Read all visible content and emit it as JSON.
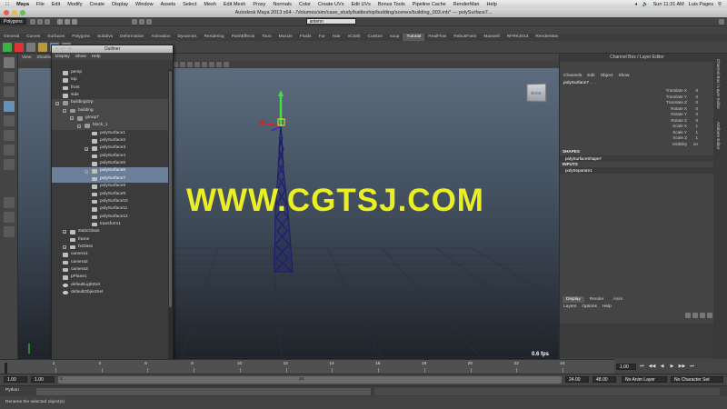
{
  "mac_menubar": {
    "apple": "",
    "app": "Maya",
    "items": [
      "File",
      "Edit",
      "Modify",
      "Create",
      "Display",
      "Window",
      "Assets",
      "Select",
      "Mesh",
      "Edit Mesh",
      "Proxy",
      "Normals",
      "Color",
      "Create UVs",
      "Edit UVs",
      "Bonus Tools",
      "Pipeline Cache",
      "RenderMan",
      "Help"
    ],
    "clock": "Sun 11:31 AM",
    "user": "Luis Pages"
  },
  "window_title": "Autodesk Maya 2013 x64 - /Volumes/sim/case_study/battleship/building/scenes/building_003.mb* --- polySurface7...",
  "status_line": {
    "menu_set": "Polygons",
    "search_value": "antenn"
  },
  "shelf": {
    "tabs": [
      "General",
      "Curves",
      "Surfaces",
      "Polygons",
      "Subdivs",
      "Deformation",
      "Animation",
      "Dynamics",
      "Rendering",
      "PaintEffects",
      "Toon",
      "Muscle",
      "Fluids",
      "Fur",
      "Hair",
      "nCloth",
      "Custom",
      "soup",
      "Tutorial",
      "RealFlow",
      "RebusFarm",
      "Maxwell",
      "RFRK2013",
      "RenderMan"
    ],
    "active_tab": "Tutorial"
  },
  "outliner": {
    "title": "Outliner",
    "menu": [
      "Display",
      "Show",
      "Help"
    ],
    "items": [
      {
        "label": "persp",
        "indent": 0
      },
      {
        "label": "top",
        "indent": 0
      },
      {
        "label": "front",
        "indent": 0
      },
      {
        "label": "side",
        "indent": 0
      },
      {
        "label": "buildingGrp",
        "indent": 0,
        "expand": "−",
        "group": true
      },
      {
        "label": "building",
        "indent": 1,
        "expand": "−",
        "group": true
      },
      {
        "label": "group7",
        "indent": 2,
        "expand": "−",
        "group": true
      },
      {
        "label": "block_1",
        "indent": 3,
        "expand": "−",
        "group": true
      },
      {
        "label": "polySurface1",
        "indent": 4
      },
      {
        "label": "polySurface2",
        "indent": 4
      },
      {
        "label": "polySurface3",
        "indent": 4,
        "expand": "+"
      },
      {
        "label": "polySurface4",
        "indent": 4
      },
      {
        "label": "polySurface5",
        "indent": 4
      },
      {
        "label": "polySurface6",
        "indent": 4,
        "selected": true,
        "expand": "+"
      },
      {
        "label": "polySurface7",
        "indent": 4,
        "selected": true
      },
      {
        "label": "polySurface8",
        "indent": 4
      },
      {
        "label": "polySurface9",
        "indent": 4
      },
      {
        "label": "polySurface10",
        "indent": 4
      },
      {
        "label": "polySurface11",
        "indent": 4
      },
      {
        "label": "polySurface12",
        "indent": 4
      },
      {
        "label": "transform1",
        "indent": 4
      },
      {
        "label": "staticGlass",
        "indent": 1,
        "expand": "+"
      },
      {
        "label": "frame",
        "indent": 1
      },
      {
        "label": "fxGlass",
        "indent": 1,
        "expand": "+"
      },
      {
        "label": "camera1",
        "indent": 0
      },
      {
        "label": "camera2",
        "indent": 0
      },
      {
        "label": "camera3",
        "indent": 0
      },
      {
        "label": "pPlane1",
        "indent": 0
      },
      {
        "label": "defaultLightSet",
        "indent": 0,
        "set": true
      },
      {
        "label": "defaultObjectSet",
        "indent": 0,
        "set": true
      }
    ]
  },
  "viewport": {
    "menu": [
      "View",
      "Shading"
    ],
    "viewcube_label": "BACK",
    "watermark": "WWW.CGTSJ.COM",
    "fps": "0.6 fps"
  },
  "channel_box": {
    "title": "Channel Box / Layer Editor",
    "menu": [
      "Channels",
      "Edit",
      "Object",
      "Show"
    ],
    "object_name": "polySurface7 . . .",
    "attributes": [
      "Translate X",
      "Translate Y",
      "Translate Z",
      "Rotate X",
      "Rotate Y",
      "Rotate Z",
      "Scale X",
      "Scale Y",
      "Scale Z",
      "Visibility"
    ],
    "values": [
      "0",
      "0",
      "0",
      "0",
      "0",
      "0",
      "1",
      "1",
      "1",
      "on"
    ],
    "shapes_label": "SHAPES",
    "shape_item": "polySurfaceShape7",
    "inputs_label": "INPUTS",
    "input_item": "polySeparate1",
    "layer_tabs": [
      "Display",
      "Render",
      "Anim"
    ],
    "active_layer_tab": "Display",
    "layer_menu": [
      "Layers",
      "Options",
      "Help"
    ]
  },
  "side_tabs": [
    "Channel Box / Layer Editor",
    "Attribute Editor"
  ],
  "time_slider": {
    "ticks": [
      "2",
      "4",
      "6",
      "8",
      "10",
      "12",
      "14",
      "16",
      "18",
      "20",
      "22",
      "24"
    ],
    "current_frame": "1.00"
  },
  "range_slider": {
    "start": "1.00",
    "start2": "1.00",
    "current": "1",
    "end_marker": "24",
    "end": "24.00",
    "end2": "48.00",
    "anim_layer": "No Anim Layer",
    "char_set": "No Character Set"
  },
  "command_line": {
    "label": "Python"
  },
  "help_line": "Rename the selected object(s)",
  "colors": {
    "accent_selected": "#6b7f99",
    "watermark": "#e9ef24",
    "tower": "#1d1f6a",
    "manip_y": "#3fe03f",
    "manip_x": "#e02020",
    "manip_z": "#2030e0"
  }
}
